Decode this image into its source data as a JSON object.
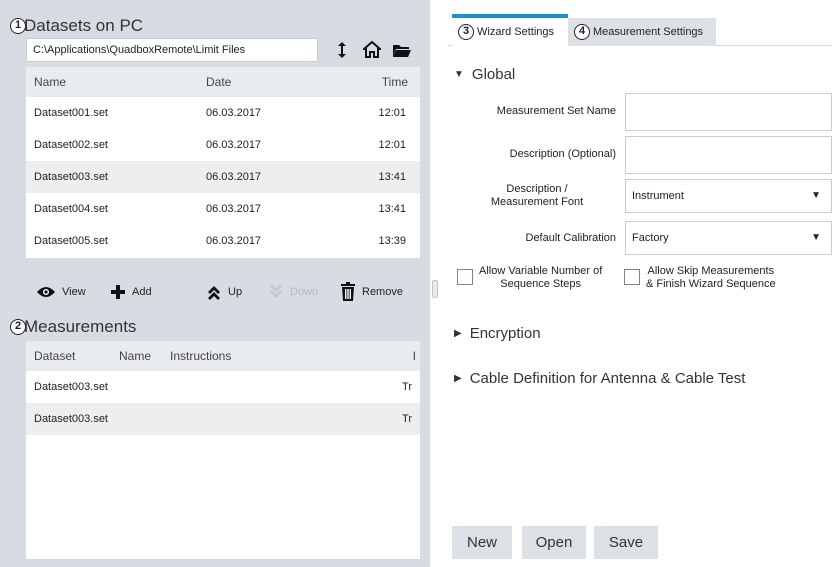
{
  "left": {
    "datasets": {
      "callout": "1",
      "title": "Datasets on PC",
      "path": "C:\\Applications\\QuadboxRemote\\Limit Files",
      "columns": [
        "Name",
        "Date",
        "Time"
      ],
      "rows": [
        {
          "name": "Dataset001.set",
          "date": "06.03.2017",
          "time": "12:01"
        },
        {
          "name": "Dataset002.set",
          "date": "06.03.2017",
          "time": "12:01"
        },
        {
          "name": "Dataset003.set",
          "date": "06.03.2017",
          "time": "13:41"
        },
        {
          "name": "Dataset004.set",
          "date": "06.03.2017",
          "time": "13:41"
        },
        {
          "name": "Dataset005.set",
          "date": "06.03.2017",
          "time": "13:39"
        }
      ],
      "actions": {
        "view": "View",
        "add": "Add",
        "up": "Up",
        "down": "Down",
        "remove": "Remove"
      }
    },
    "measurements": {
      "callout": "2",
      "title": "Measurements",
      "columns": [
        "Dataset",
        "Name",
        "Instructions",
        "I"
      ],
      "rows": [
        {
          "dataset": "Dataset003.set",
          "name": "",
          "instructions": "",
          "extra": "Tr"
        },
        {
          "dataset": "Dataset003.set",
          "name": "",
          "instructions": "",
          "extra": "Tr"
        }
      ]
    }
  },
  "right": {
    "tabs": [
      {
        "callout": "3",
        "label": "Wizard Settings"
      },
      {
        "callout": "4",
        "label": "Measurement Settings"
      }
    ],
    "global": {
      "title": "Global",
      "measurement_set_name_label": "Measurement Set Name",
      "description_label": "Description (Optional)",
      "font_label_line1": "Description /",
      "font_label_line2": "Measurement Font",
      "font_value": "Instrument",
      "calibration_label": "Default Calibration",
      "calibration_value": "Factory",
      "chk_variable_line1": "Allow Variable Number of",
      "chk_variable_line2": "Sequence Steps",
      "chk_skip_line1": "Allow Skip Measurements",
      "chk_skip_line2": "& Finish Wizard Sequence"
    },
    "encryption": "Encryption",
    "cable": "Cable Definition for Antenna & Cable Test",
    "buttons": {
      "new": "New",
      "open": "Open",
      "save": "Save"
    }
  },
  "colors": {
    "tab_accent": "#1e8fd6",
    "panel_bg": "#d7dce2"
  }
}
